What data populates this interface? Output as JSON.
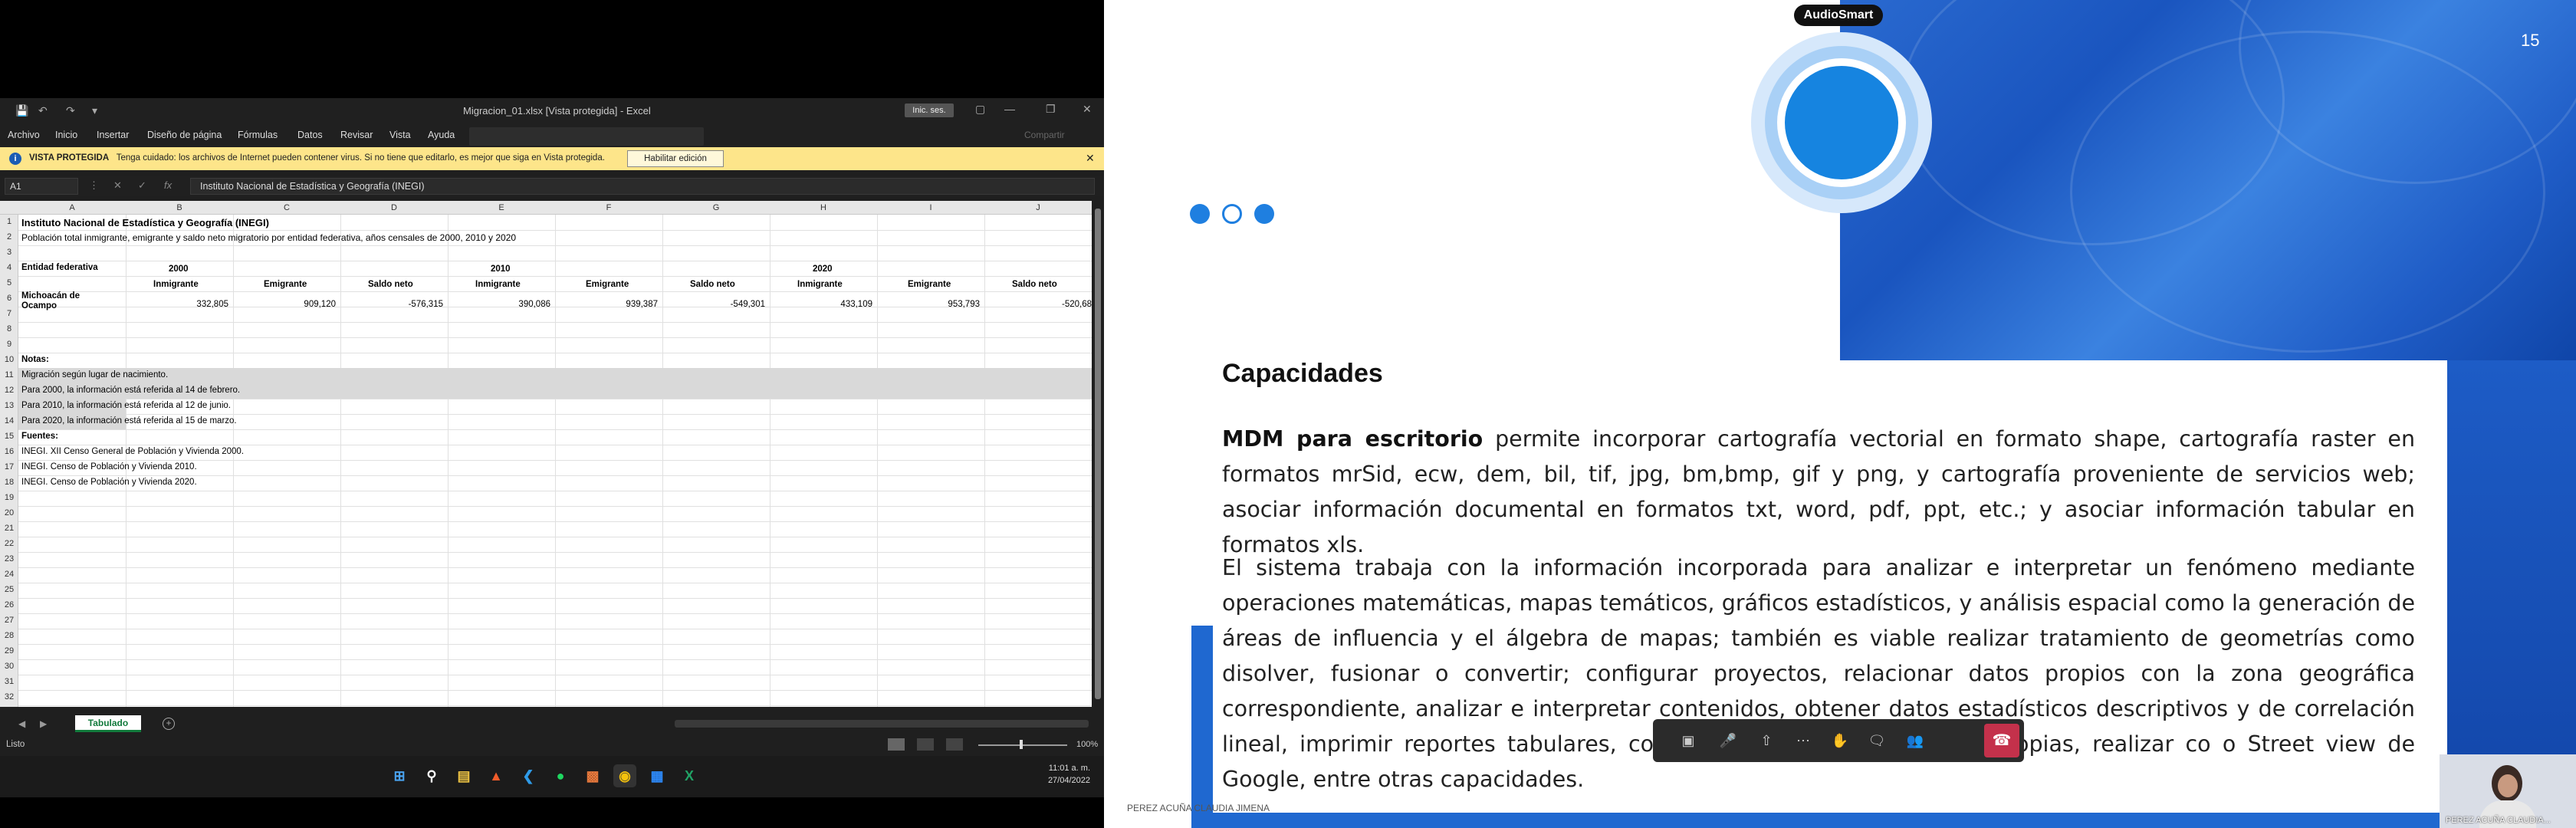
{
  "excel": {
    "doc_title": "Migracion_01.xlsx  [Vista protegida]  -  Excel",
    "signin": "Inic. ses.",
    "menu": [
      "Archivo",
      "Inicio",
      "Insertar",
      "Diseño de página",
      "Fórmulas",
      "Datos",
      "Revisar",
      "Vista",
      "Ayuda"
    ],
    "share": "Compartir",
    "warning": {
      "title": "VISTA PROTEGIDA",
      "text": "Tenga cuidado: los archivos de Internet pueden contener virus. Si no tiene que editarlo, es mejor que siga en Vista protegida.",
      "button": "Habilitar edición"
    },
    "namebox": "A1",
    "formula": "Instituto Nacional de Estadística y Geografía (INEGI)",
    "columns": [
      "A",
      "B",
      "C",
      "D",
      "E",
      "F",
      "G",
      "H",
      "I",
      "J"
    ],
    "cells": {
      "r1": "Instituto Nacional de Estadística y Geografía (INEGI)",
      "r2": "Población total inmigrante, emigrante y saldo neto migratorio por entidad federativa, años censales de 2000, 2010 y 2020",
      "entidad": "Entidad federativa",
      "y2000": "2000",
      "y2010": "2010",
      "y2020": "2020",
      "inm": "Inmigrante",
      "emi": "Emigrante",
      "sal": "Saldo neto",
      "state": "Michoacán de",
      "state2": "Ocampo",
      "values": [
        "332,805",
        "909,120",
        "-576,315",
        "390,086",
        "939,387",
        "-549,301",
        "433,109",
        "953,793",
        "-520,68"
      ],
      "notas": "Notas:",
      "n1": "Migración según lugar de nacimiento.",
      "n2": "Para 2000, la información está referida al 14 de febrero.",
      "n3": "Para 2010, la información está referida al 12 de junio.",
      "n4": "Para 2020, la información está referida al 15 de marzo.",
      "fuentes": "Fuentes:",
      "f1": "INEGI. XII Censo General de Población y Vivienda 2000.",
      "f2": "INEGI. Censo de Población y Vivienda 2010.",
      "f3": "INEGI. Censo de Población y Vivienda 2020."
    },
    "sheet_tab": "Tabulado",
    "status": "Listo",
    "zoom": "100%"
  },
  "taskbar": {
    "time": "11:01 a. m.",
    "date": "27/04/2022"
  },
  "slide": {
    "badge": "AudioSmart",
    "number": "15",
    "title": "Capacidades",
    "p1_bold": "MDM para escritorio",
    "p1_rest": " permite incorporar cartografía vectorial en formato shape, cartografía raster en formatos mrSid, ecw, dem, bil, tif, jpg, bm,bmp, gif y png, y cartografía proveniente de servicios web; asociar información documental en formatos txt, word, pdf, ppt, etc.; y asociar información tabular en formatos xls.",
    "p2": "El sistema  trabaja con la información incorporada para analizar e interpretar un fenómeno mediante operaciones matemáticas, mapas temáticos, gráficos estadísticos, y análisis espacial como la generación de áreas de influencia y el álgebra de mapas; también es viable realizar tratamiento de geometrías como disolver, fusionar o convertir; configurar proyectos, relacionar datos propios con la zona geográfica correspondiente, analizar e interpretar contenidos, obtener datos estadísticos  descriptivos y de correlación lineal, imprimir reportes tabulares,  construir capas de información propias, realizar co                                                o Street  view de Google, entre otras capacidades.",
    "presenter_caption": "PEREZ ACUÑA CLAUDIA JIMENA",
    "selfview_name": "PEREZ ACUÑA CLAUDIA..."
  },
  "colors": {
    "excel_green": "#127a3c",
    "slide_blue": "#1f68d0",
    "warn_yellow": "#fde58a",
    "end_call": "#c4314b"
  }
}
